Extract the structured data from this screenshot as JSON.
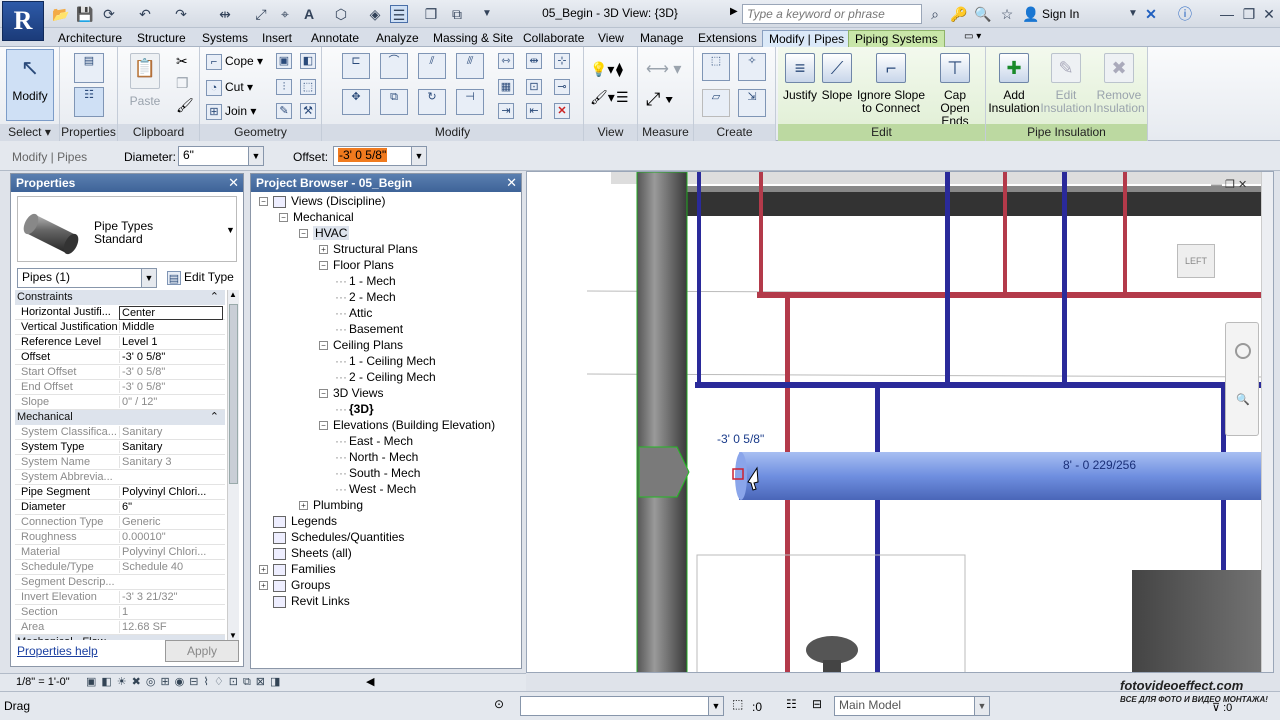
{
  "app": {
    "logo": "R",
    "title": "05_Begin - 3D View: {3D}",
    "search_placeholder": "Type a keyword or phrase",
    "sign_in": "Sign In"
  },
  "tabs": [
    "Architecture",
    "Structure",
    "Systems",
    "Insert",
    "Annotate",
    "Analyze",
    "Massing & Site",
    "Collaborate",
    "View",
    "Manage",
    "Extensions",
    "Modify | Pipes",
    "Piping Systems"
  ],
  "ribbon": {
    "select": {
      "modify": "Modify",
      "label": "Select ▾"
    },
    "properties": {
      "label": "Properties"
    },
    "clipboard": {
      "paste": "Paste",
      "label": "Clipboard"
    },
    "geometry": {
      "cope": "Cope",
      "cut": "Cut",
      "join": "Join",
      "label": "Geometry"
    },
    "modify": {
      "label": "Modify"
    },
    "view": {
      "label": "View"
    },
    "measure": {
      "label": "Measure"
    },
    "create": {
      "label": "Create"
    },
    "edit": {
      "justify": "Justify",
      "slope": "Slope",
      "ignore_slope": "Ignore Slope",
      "ignore_slope2": "to Connect",
      "cap": "Cap",
      "cap2": "Open Ends",
      "label": "Edit"
    },
    "insulation": {
      "add": "Add",
      "add2": "Insulation",
      "edit": "Edit",
      "edit2": "Insulation",
      "remove": "Remove",
      "remove2": "Insulation",
      "label": "Pipe Insulation"
    }
  },
  "options_bar": {
    "context": "Modify | Pipes",
    "diameter_label": "Diameter:",
    "diameter_value": "6\"",
    "offset_label": "Offset:",
    "offset_value": "-3'  0 5/8\""
  },
  "properties": {
    "title": "Properties",
    "type_name": "Pipe Types",
    "type_sub": "Standard",
    "filter": "Pipes (1)",
    "edit_type": "Edit Type",
    "sections": [
      {
        "name": "Constraints",
        "rows": [
          {
            "k": "Horizontal Justifi...",
            "v": "Center",
            "ro": false
          },
          {
            "k": "Vertical Justification",
            "v": "Middle",
            "ro": false
          },
          {
            "k": "Reference Level",
            "v": "Level 1",
            "ro": false
          },
          {
            "k": "Offset",
            "v": "-3'  0 5/8\"",
            "ro": false
          },
          {
            "k": "Start Offset",
            "v": "-3'  0 5/8\"",
            "ro": true
          },
          {
            "k": "End Offset",
            "v": "-3'  0 5/8\"",
            "ro": true
          },
          {
            "k": "Slope",
            "v": "0\" / 12\"",
            "ro": true
          }
        ]
      },
      {
        "name": "Mechanical",
        "rows": [
          {
            "k": "System Classifica...",
            "v": "Sanitary",
            "ro": true
          },
          {
            "k": "System Type",
            "v": "Sanitary",
            "ro": false
          },
          {
            "k": "System Name",
            "v": "Sanitary 3",
            "ro": true
          },
          {
            "k": "System Abbrevia...",
            "v": "",
            "ro": true
          },
          {
            "k": "Pipe Segment",
            "v": "Polyvinyl Chlori...",
            "ro": false
          },
          {
            "k": "Diameter",
            "v": "6\"",
            "ro": false
          },
          {
            "k": "Connection Type",
            "v": "Generic",
            "ro": true
          },
          {
            "k": "Roughness",
            "v": "0.00010\"",
            "ro": true
          },
          {
            "k": "Material",
            "v": "Polyvinyl Chlori...",
            "ro": true
          },
          {
            "k": "Schedule/Type",
            "v": "Schedule 40",
            "ro": true
          },
          {
            "k": "Segment Descrip...",
            "v": "",
            "ro": true
          },
          {
            "k": "Invert Elevation",
            "v": "-3'  3 21/32\"",
            "ro": true
          },
          {
            "k": "Section",
            "v": "1",
            "ro": true
          },
          {
            "k": "Area",
            "v": "12.68 SF",
            "ro": true
          }
        ]
      }
    ],
    "cut_section": "Mechanical - Flow",
    "help": "Properties help",
    "apply": "Apply"
  },
  "browser": {
    "title": "Project Browser - 05_Begin",
    "items": [
      {
        "t": "Views (Discipline)",
        "lvl": 0,
        "box": "-"
      },
      {
        "t": "Mechanical",
        "lvl": 1,
        "box": "-"
      },
      {
        "t": "HVAC",
        "lvl": 2,
        "box": "-"
      },
      {
        "t": "Structural Plans",
        "lvl": 3,
        "box": "+"
      },
      {
        "t": "Floor Plans",
        "lvl": 3,
        "box": "-"
      },
      {
        "t": "1 - Mech",
        "lvl": 4,
        "box": ""
      },
      {
        "t": "2 - Mech",
        "lvl": 4,
        "box": ""
      },
      {
        "t": "Attic",
        "lvl": 4,
        "box": ""
      },
      {
        "t": "Basement",
        "lvl": 4,
        "box": ""
      },
      {
        "t": "Ceiling Plans",
        "lvl": 3,
        "box": "-"
      },
      {
        "t": "1 - Ceiling Mech",
        "lvl": 4,
        "box": ""
      },
      {
        "t": "2 - Ceiling Mech",
        "lvl": 4,
        "box": ""
      },
      {
        "t": "3D Views",
        "lvl": 3,
        "box": "-"
      },
      {
        "t": "{3D}",
        "lvl": 4,
        "box": "",
        "bold": true
      },
      {
        "t": "Elevations (Building Elevation)",
        "lvl": 3,
        "box": "-"
      },
      {
        "t": "East - Mech",
        "lvl": 4,
        "box": ""
      },
      {
        "t": "North - Mech",
        "lvl": 4,
        "box": ""
      },
      {
        "t": "South - Mech",
        "lvl": 4,
        "box": ""
      },
      {
        "t": "West - Mech",
        "lvl": 4,
        "box": ""
      },
      {
        "t": "Plumbing",
        "lvl": 2,
        "box": "+"
      },
      {
        "t": "Legends",
        "lvl": 0,
        "box": "",
        "icon": true
      },
      {
        "t": "Schedules/Quantities",
        "lvl": 0,
        "box": "",
        "icon": true
      },
      {
        "t": "Sheets (all)",
        "lvl": 0,
        "box": "",
        "icon": true
      },
      {
        "t": "Families",
        "lvl": 0,
        "box": "+",
        "icon": true
      },
      {
        "t": "Groups",
        "lvl": 0,
        "box": "+",
        "icon": true
      },
      {
        "t": "Revit Links",
        "lvl": 0,
        "box": "",
        "icon": true
      }
    ]
  },
  "viewport": {
    "offset_label": "-3'  0 5/8\"",
    "length_label": "8' - 0 229/256",
    "viewcube": "LEFT"
  },
  "viewbar": {
    "scale": "1/8\" = 1'-0\""
  },
  "status": {
    "text": "Drag",
    "count": ":0",
    "model": "Main Model",
    "watermark": "fotovideoeffect.com",
    "watermark2": "ВСЕ ДЛЯ ФОТО И ВИДЕО МОНТАЖА!"
  },
  "colors": {
    "accent": "#3e6398",
    "pipe_blue": "#2a2a9a",
    "pipe_red": "#b33a4a",
    "selected_pipe": "#6f8fe0"
  }
}
